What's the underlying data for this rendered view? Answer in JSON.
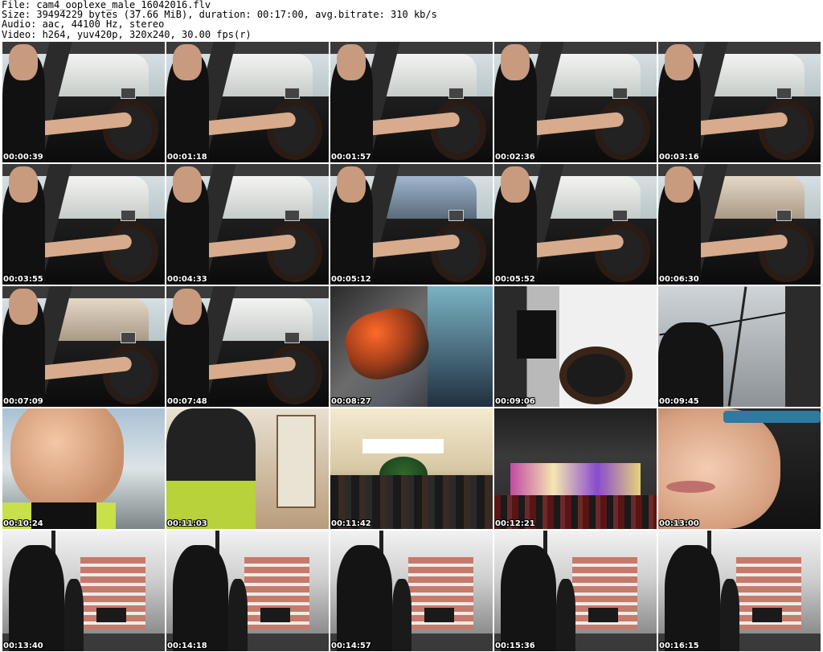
{
  "header": {
    "file": "File: cam4_ooplexe_male_16042016.flv",
    "size": "Size: 39494229 bytes (37.66 MiB), duration: 00:17:00, avg.bitrate: 310 kb/s",
    "audio": "Audio: aac, 44100 Hz, stereo",
    "video": "Video: h264, yuv420p, 320x240, 30.00 fps(r)"
  },
  "thumbnails": [
    {
      "time": "00:00:39",
      "scene": "car"
    },
    {
      "time": "00:01:18",
      "scene": "car"
    },
    {
      "time": "00:01:57",
      "scene": "car"
    },
    {
      "time": "00:02:36",
      "scene": "car"
    },
    {
      "time": "00:03:16",
      "scene": "car"
    },
    {
      "time": "00:03:55",
      "scene": "car"
    },
    {
      "time": "00:04:33",
      "scene": "car"
    },
    {
      "time": "00:05:12",
      "scene": "car-street"
    },
    {
      "time": "00:05:52",
      "scene": "car"
    },
    {
      "time": "00:06:30",
      "scene": "car-street2"
    },
    {
      "time": "00:07:09",
      "scene": "car-street2"
    },
    {
      "time": "00:07:48",
      "scene": "car"
    },
    {
      "time": "00:08:27",
      "scene": "blur"
    },
    {
      "time": "00:09:06",
      "scene": "door"
    },
    {
      "time": "00:09:45",
      "scene": "sky"
    },
    {
      "time": "00:10:24",
      "scene": "selfie"
    },
    {
      "time": "00:11:03",
      "scene": "city"
    },
    {
      "time": "00:11:42",
      "scene": "store"
    },
    {
      "time": "00:12:21",
      "scene": "night"
    },
    {
      "time": "00:13:00",
      "scene": "closeup"
    },
    {
      "time": "00:13:40",
      "scene": "bldg"
    },
    {
      "time": "00:14:18",
      "scene": "bldg"
    },
    {
      "time": "00:14:57",
      "scene": "bldg"
    },
    {
      "time": "00:15:36",
      "scene": "bldg"
    },
    {
      "time": "00:16:15",
      "scene": "bldg"
    }
  ]
}
